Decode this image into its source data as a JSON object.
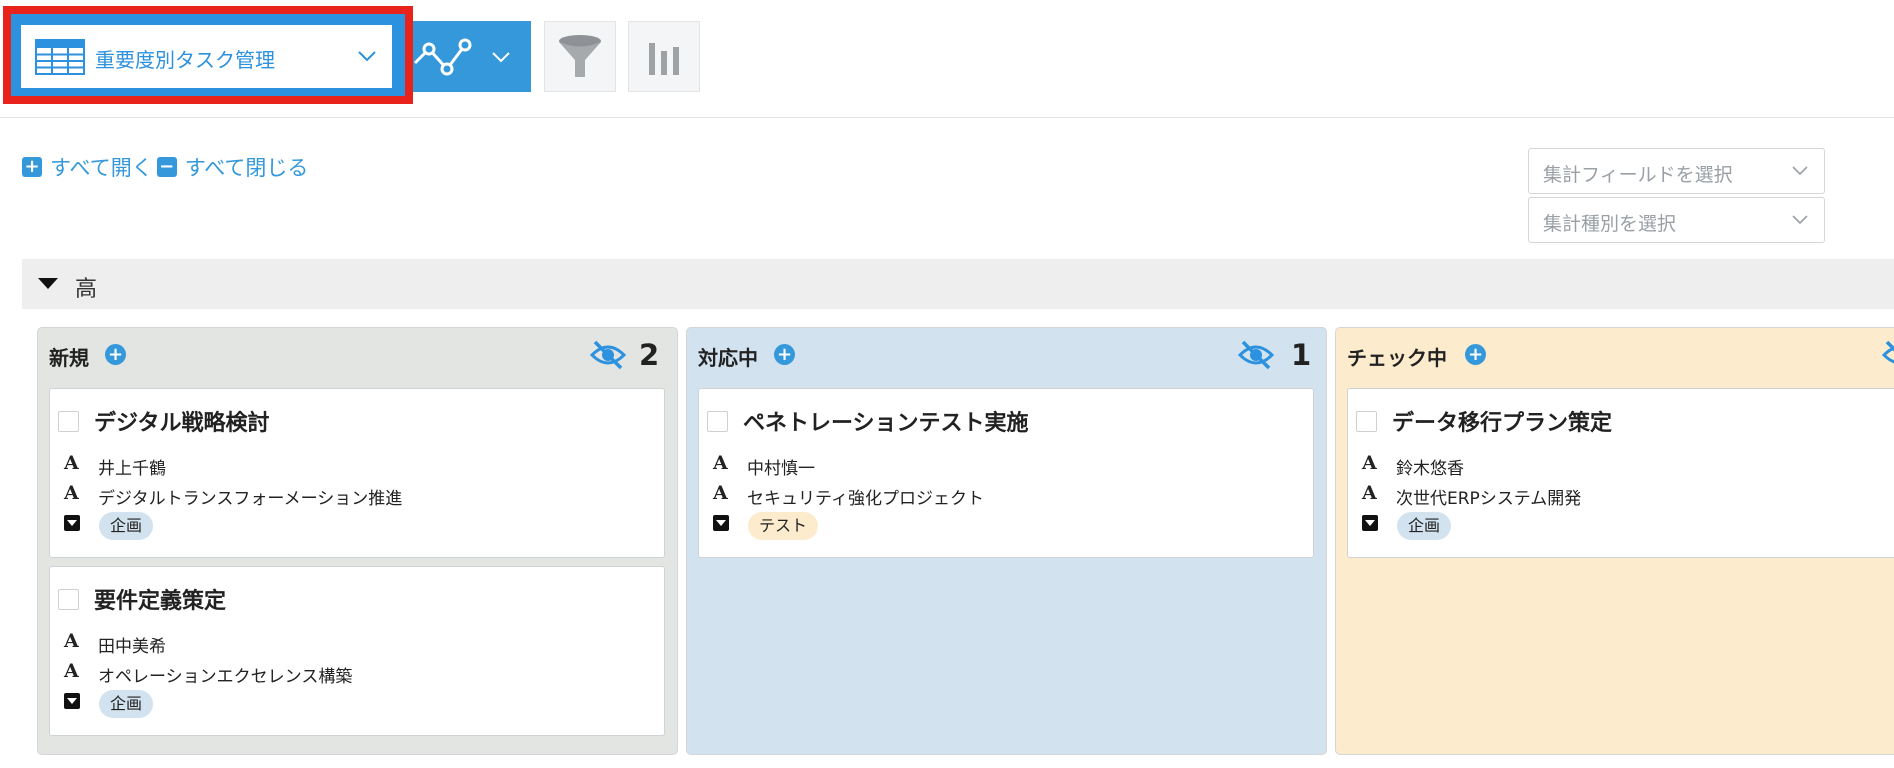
{
  "toolbar": {
    "view_selector_label": "重要度別タスク管理",
    "view_icon": "table-icon",
    "graph_icon": "line-graph-icon",
    "filter_icon": "funnel-icon",
    "chart_icon": "bar-chart-icon",
    "accent_color": "#3498db",
    "highlight_color": "#e8231b"
  },
  "expand_all_label": "すべて開く",
  "collapse_all_label": "すべて閉じる",
  "aggregate": {
    "field_placeholder": "集計フィールドを選択",
    "type_placeholder": "集計種別を選択"
  },
  "group": {
    "title": "高"
  },
  "columns": [
    {
      "title": "対応中",
      "count": "1",
      "bg_color": "#d2e3ef",
      "cards": [
        {
          "title": "ペネトレーションテスト実施",
          "assignee": "中村慎一",
          "project": "セキュリティ強化プロジェクト",
          "category": "テスト",
          "category_color": "#fcebcc"
        }
      ]
    },
    {
      "title": "新規",
      "count": "2",
      "bg_color": "#e3e5e2",
      "cards": [
        {
          "title": "デジタル戦略検討",
          "assignee": "井上千鶴",
          "project": "デジタルトランスフォーメーション推進",
          "category": "企画",
          "category_color": "#d2e3ef"
        },
        {
          "title": "要件定義策定",
          "assignee": "田中美希",
          "project": "オペレーションエクセレンス構築",
          "category": "企画",
          "category_color": "#d2e3ef"
        }
      ]
    },
    {
      "title": "チェック中",
      "count": "",
      "bg_color": "#fcebcc",
      "cards": [
        {
          "title": "データ移行プラン策定",
          "assignee": "鈴木悠香",
          "project": "次世代ERPシステム開発",
          "category": "企画",
          "category_color": "#d2e3ef"
        }
      ]
    }
  ]
}
